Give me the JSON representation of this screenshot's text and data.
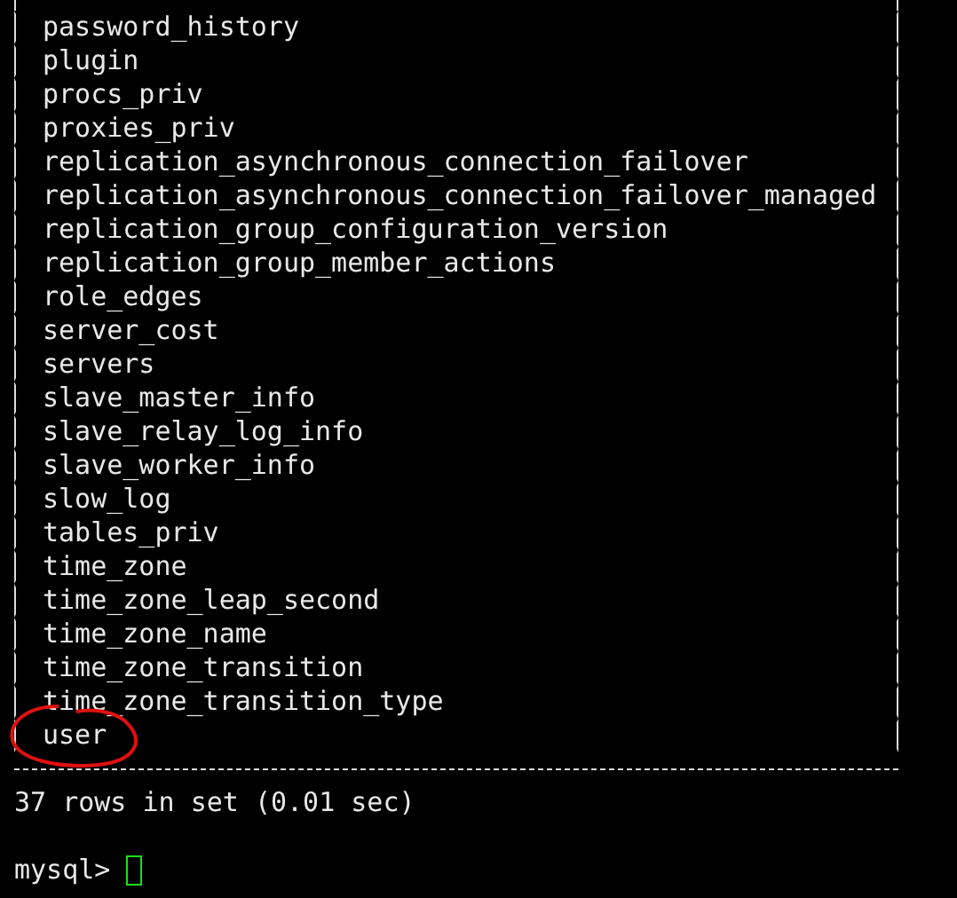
{
  "table_rows": [
    {
      "name": "password_history",
      "circled": false
    },
    {
      "name": "plugin",
      "circled": false
    },
    {
      "name": "procs_priv",
      "circled": false
    },
    {
      "name": "proxies_priv",
      "circled": false
    },
    {
      "name": "replication_asynchronous_connection_failover",
      "circled": false
    },
    {
      "name": "replication_asynchronous_connection_failover_managed",
      "circled": false
    },
    {
      "name": "replication_group_configuration_version",
      "circled": false
    },
    {
      "name": "replication_group_member_actions",
      "circled": false
    },
    {
      "name": "role_edges",
      "circled": false
    },
    {
      "name": "server_cost",
      "circled": false
    },
    {
      "name": "servers",
      "circled": false
    },
    {
      "name": "slave_master_info",
      "circled": false
    },
    {
      "name": "slave_relay_log_info",
      "circled": false
    },
    {
      "name": "slave_worker_info",
      "circled": false
    },
    {
      "name": "slow_log",
      "circled": false
    },
    {
      "name": "tables_priv",
      "circled": false
    },
    {
      "name": "time_zone",
      "circled": false
    },
    {
      "name": "time_zone_leap_second",
      "circled": false
    },
    {
      "name": "time_zone_name",
      "circled": false
    },
    {
      "name": "time_zone_transition",
      "circled": false
    },
    {
      "name": "time_zone_transition_type",
      "circled": false
    },
    {
      "name": "user",
      "circled": true
    }
  ],
  "result_line": "37 rows in set (0.01 sec)",
  "prompt": "mysql>"
}
